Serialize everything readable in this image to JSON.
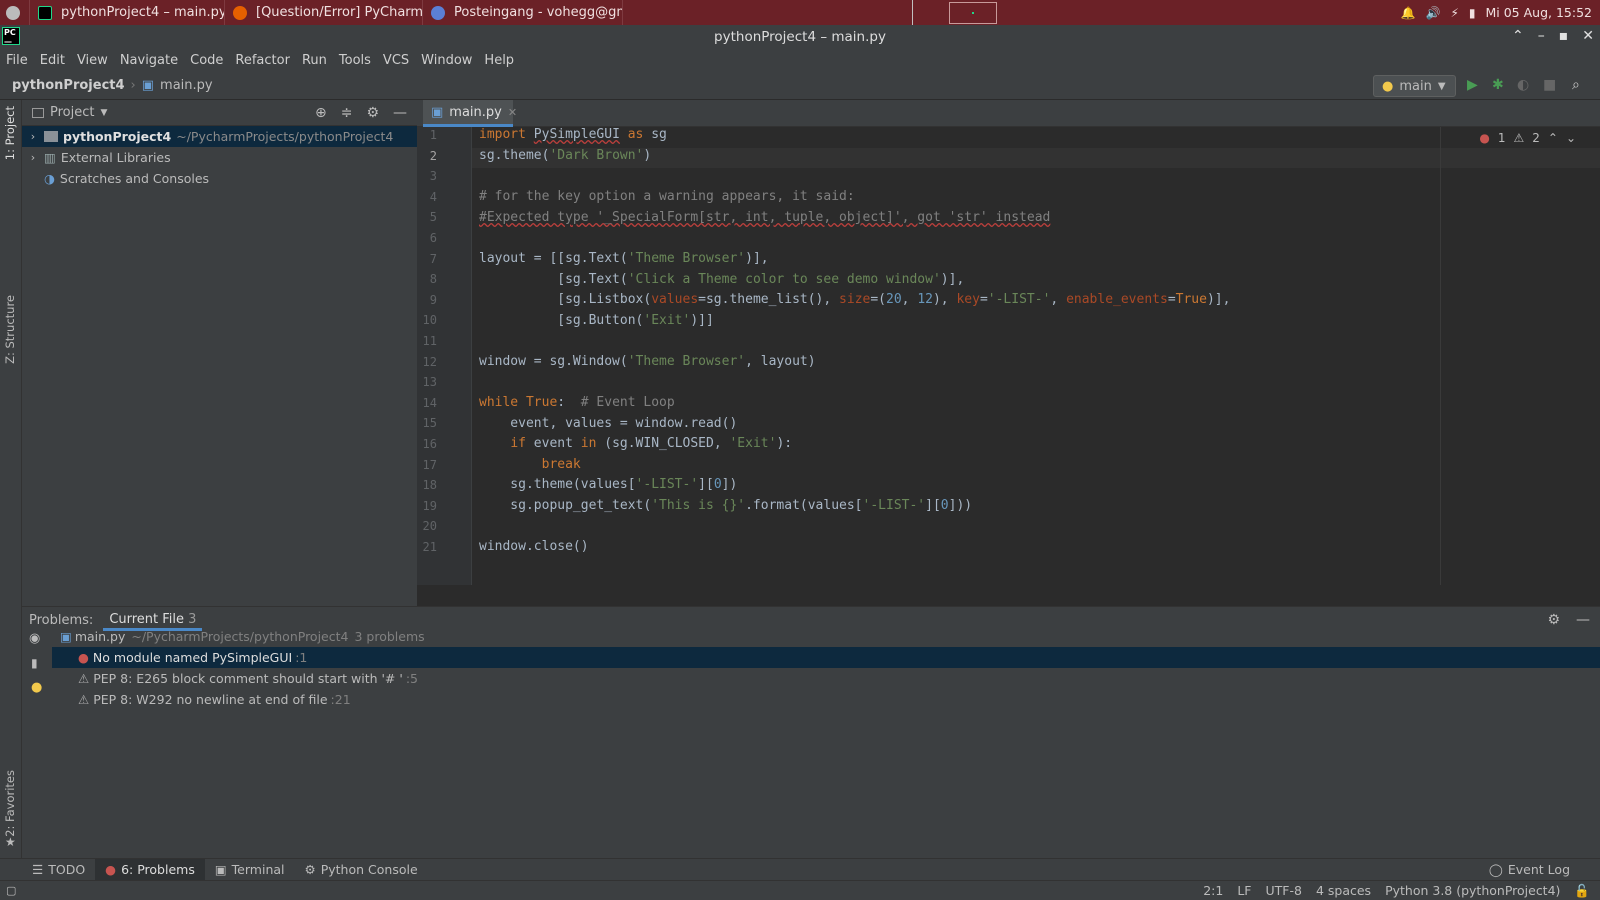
{
  "taskbar": {
    "tasks": [
      {
        "label": "pythonProject4 – main.py"
      },
      {
        "label": "[Question/Error] PyCharm I..."
      },
      {
        "label": "Posteingang - vohegg@gmai..."
      }
    ],
    "clock": "Mi 05 Aug, 15:52"
  },
  "window": {
    "title": "pythonProject4 – main.py"
  },
  "menu": [
    "File",
    "Edit",
    "View",
    "Navigate",
    "Code",
    "Refactor",
    "Run",
    "Tools",
    "VCS",
    "Window",
    "Help"
  ],
  "nav": {
    "project": "pythonProject4",
    "file": "main.py",
    "run_config": "main"
  },
  "sidebar": {
    "project_tab": "1: Project",
    "structure_tab": "Z: Structure",
    "favorites_tab": "2: Favorites"
  },
  "project_panel": {
    "title": "Project",
    "items": [
      {
        "label": "pythonProject4",
        "path": "~/PycharmProjects/pythonProject4"
      },
      {
        "label": "External Libraries"
      },
      {
        "label": "Scratches and Consoles"
      }
    ]
  },
  "editor": {
    "tab": "main.py",
    "errors": "1",
    "warnings": "2",
    "line_numbers": [
      "1",
      "2",
      "3",
      "4",
      "5",
      "6",
      "7",
      "8",
      "9",
      "10",
      "11",
      "12",
      "13",
      "14",
      "15",
      "16",
      "17",
      "18",
      "19",
      "20",
      "21"
    ]
  },
  "problems": {
    "label": "Problems:",
    "tab": "Current File",
    "count": "3",
    "file": "main.py",
    "file_path": "~/PycharmProjects/pythonProject4",
    "file_summary": "3 problems",
    "items": [
      {
        "text": "No module named PySimpleGUI",
        "loc": ":1",
        "severity": "error"
      },
      {
        "text": "PEP 8: E265 block comment should start with '# '",
        "loc": ":5",
        "severity": "warning"
      },
      {
        "text": "PEP 8: W292 no newline at end of file",
        "loc": ":21",
        "severity": "warning"
      }
    ]
  },
  "bottom_tabs": [
    {
      "label": "TODO"
    },
    {
      "label": "6: Problems"
    },
    {
      "label": "Terminal"
    },
    {
      "label": "Python Console"
    }
  ],
  "event_log": "Event Log",
  "status": {
    "position": "2:1",
    "line_sep": "LF",
    "encoding": "UTF-8",
    "indent": "4 spaces",
    "interpreter": "Python 3.8 (pythonProject4)"
  },
  "colors": {
    "taskbar": "#6b2127",
    "selection": "#0d293e",
    "run_green": "#499c54",
    "error_red": "#c75450"
  }
}
